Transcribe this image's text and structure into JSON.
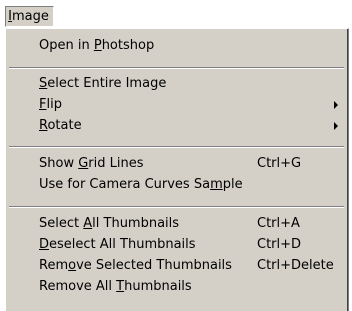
{
  "menu_bar": {
    "title": "Image",
    "title_mnemonic": "I"
  },
  "menu": {
    "items": [
      {
        "pre": "Open in ",
        "mn": "P",
        "post": "hotshop",
        "shortcut": "",
        "submenu": false
      },
      {
        "pre": "",
        "mn": "S",
        "post": "elect Entire Image",
        "shortcut": "",
        "submenu": false
      },
      {
        "pre": "",
        "mn": "F",
        "post": "lip",
        "shortcut": "",
        "submenu": true
      },
      {
        "pre": "",
        "mn": "R",
        "post": "otate",
        "shortcut": "",
        "submenu": true
      },
      {
        "pre": "Show ",
        "mn": "G",
        "post": "rid Lines",
        "shortcut": "Ctrl+G",
        "submenu": false
      },
      {
        "pre": "Use for Camera Curves Sa",
        "mn": "m",
        "post": "ple",
        "shortcut": "",
        "submenu": false
      },
      {
        "pre": "Select ",
        "mn": "A",
        "post": "ll Thumbnails",
        "shortcut": "Ctrl+A",
        "submenu": false
      },
      {
        "pre": "",
        "mn": "D",
        "post": "eselect All Thumbnails",
        "shortcut": "Ctrl+D",
        "submenu": false
      },
      {
        "pre": "Rem",
        "mn": "o",
        "post": "ve Selected Thumbnails",
        "shortcut": "Ctrl+Delete",
        "submenu": false
      },
      {
        "pre": "Remove All ",
        "mn": "T",
        "post": "humbnails",
        "shortcut": "",
        "submenu": false
      }
    ]
  },
  "colors": {
    "menu_face": "#d4d0c8",
    "highlight": "#ffffff",
    "shadow": "#808080",
    "text": "#000000"
  }
}
